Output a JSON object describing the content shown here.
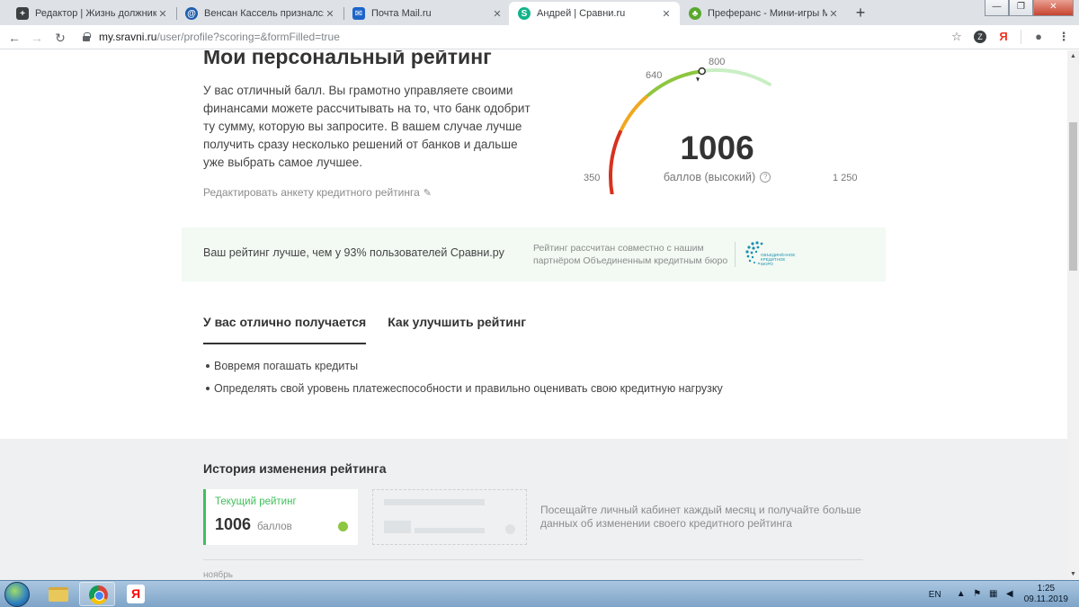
{
  "browser": {
    "tabs": [
      {
        "title": "Редактор | Жизнь должника | Я",
        "icon": "plus-square-icon",
        "color": "#3c4043"
      },
      {
        "title": "Венсан Кассель признался в лю",
        "icon": "globe-icon",
        "color": "#1e5fae"
      },
      {
        "title": "Почта Mail.ru",
        "icon": "mail-icon",
        "color": "#1d64c9"
      },
      {
        "title": "Андрей | Сравни.ru",
        "icon": "sravni-icon",
        "color": "#14b38a"
      },
      {
        "title": "Преферанс - Мини-игры Mail.R",
        "icon": "cards-icon",
        "color": "#5aa82f"
      }
    ],
    "active_tab": 3,
    "url_host": "my.sravni.ru",
    "url_path": "/user/profile?scoring=&formFilled=true",
    "ext_label": "Я",
    "menu_icon": "⋮"
  },
  "rating": {
    "title": "Мои персональный рейтинг",
    "description": "У вас отличный балл. Вы грамотно управляете своими финансами можете рассчитывать на то, что банк одобрит ту сумму, которую вы запросите. В вашем случае лучше получить сразу несколько решений от банков и дальше уже выбрать самое лучшее.",
    "edit_link": "Редактировать анкету кредитного рейтинга",
    "score": "1006",
    "score_caption": "баллов (высокий)",
    "scale": {
      "min": "350",
      "max": "1 250",
      "mark1": "640",
      "mark2": "800"
    },
    "gauge_min": 350,
    "gauge_max": 1250,
    "gauge_value": 1006,
    "gauge_colors": {
      "low": "#d8321e",
      "mid": "#f0a820",
      "high": "#8dc63f",
      "rest": "#c9eec4"
    }
  },
  "banner": {
    "text": "Ваш рейтинг лучше, чем у 93% пользователей Сравни.ру",
    "partner_text": "Рейтинг рассчитан совместно с нашим партнёром Объединенным кредитным бюро",
    "logo_text": "Объединённое кредитное бюро"
  },
  "tabs": [
    {
      "label": "У вас отлично получается",
      "active": true
    },
    {
      "label": "Как улучшить рейтинг",
      "active": false
    }
  ],
  "tips": [
    "Вовремя погашать кредиты",
    "Определять свой уровень платежеспособности и правильно оценивать свою кредитную нагрузку"
  ],
  "history": {
    "title": "История изменения рейтинга",
    "current_label": "Текущий рейтинг",
    "current_value": "1006",
    "current_unit": "баллов",
    "hint": "Посещайте личный кабинет каждый месяц и получайте больше данных об изменении своего кредитного рейтинга",
    "month": "ноябрь"
  },
  "taskbar": {
    "lang": "EN",
    "time": "1:25",
    "date": "09.11.2019",
    "yandex_label": "Я"
  }
}
